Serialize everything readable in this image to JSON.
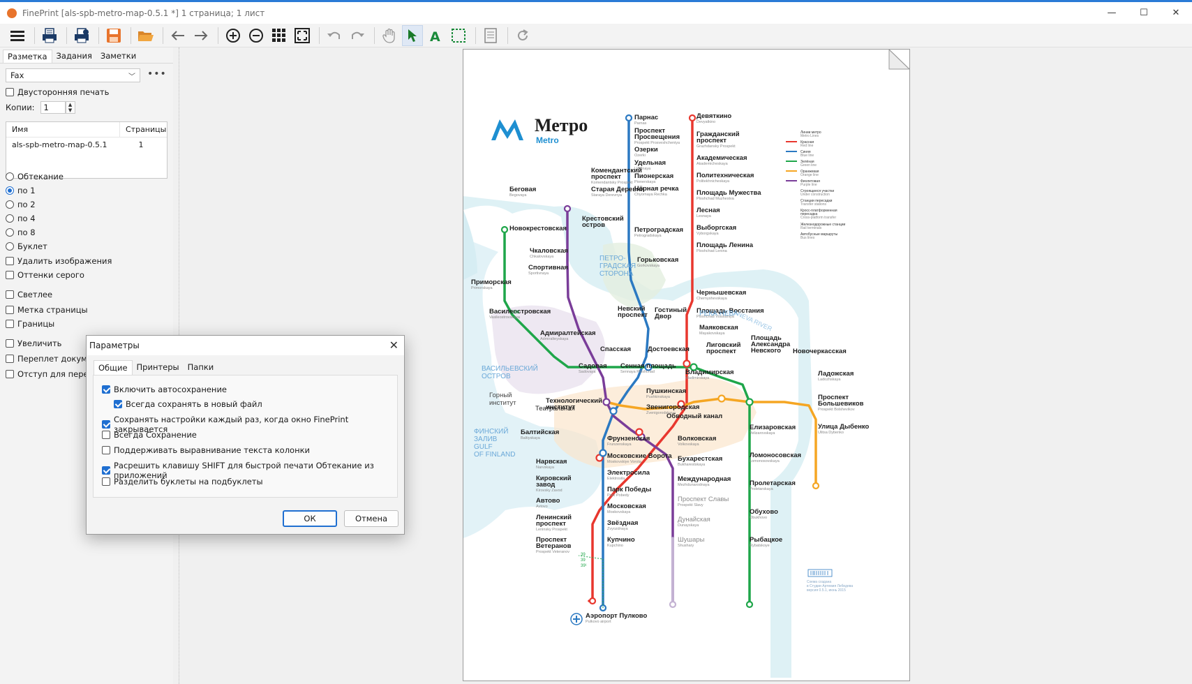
{
  "window": {
    "title": "FinePrint [als-spb-metro-map-0.5.1 *] 1 страница; 1 лист",
    "minimize": "—",
    "maximize": "☐",
    "close": "✕"
  },
  "toolbar": {
    "icons": [
      "menu-icon",
      "print-icon",
      "print-settings-icon",
      "save-icon",
      "open-folder-icon",
      "back-arrow-icon",
      "forward-arrow-icon",
      "zoom-in-icon",
      "zoom-out-icon",
      "grid-icon",
      "fit-page-icon",
      "undo-icon",
      "redo-icon",
      "hand-icon",
      "pointer-icon",
      "text-icon",
      "selection-icon",
      "notes-icon",
      "refresh-icon"
    ]
  },
  "left_panel": {
    "tabs": [
      "Разметка",
      "Задания",
      "Заметки"
    ],
    "printer": "Fax",
    "more": "•••",
    "duplex_label": "Двусторонняя печать",
    "copies_label": "Копии:",
    "copies_value": "1",
    "spin_up": "▲",
    "spin_down": "▼",
    "jobs_table": {
      "col_name": "Имя",
      "col_pages": "Страницы",
      "rows": [
        {
          "name": "als-spb-metro-map-0.5.1",
          "pages": "1"
        }
      ]
    },
    "layout_options": [
      "Обтекание",
      "по 1",
      "по 2",
      "по 4",
      "по 8",
      "Буклет"
    ],
    "selected_layout": "по 1",
    "remove_images": "Удалить изображения",
    "grayscale": "Оттенки серого",
    "lighter": "Светлее",
    "page_mark": "Метка страницы",
    "borders": "Границы",
    "enlarge": "Увеличить",
    "binding_doc": "Переплет докумен",
    "binding_margin": "Отступ для перепл"
  },
  "dialog": {
    "title": "Параметры",
    "close": "✕",
    "tabs": [
      "Общие",
      "Принтеры",
      "Папки"
    ],
    "options": [
      {
        "label": "Включить автосохранение",
        "checked": true
      },
      {
        "label": "Всегда сохранять в новый файл",
        "checked": true
      },
      {
        "label": "Сохранять настройки каждый раз, когда окно FinePrint закрывается",
        "checked": true
      },
      {
        "label": "Всегда Сохранение",
        "checked": false
      },
      {
        "label": "Поддерживать выравнивание текста колонки",
        "checked": false
      },
      {
        "label": "Расрешить клавишу SHIFT для быстрой печати Обтекание из приложений",
        "checked": true
      },
      {
        "label": "Разделить буклеты на подбуклеты",
        "checked": false
      }
    ],
    "ok": "ОК",
    "cancel": "Отмена"
  },
  "map": {
    "logo_title": "Метро",
    "logo_sub": "Metro",
    "colors": {
      "red": "#e8372e",
      "blue": "#2b79c2",
      "green": "#1fa64a",
      "orange": "#f5a623",
      "purple": "#7a3d99"
    },
    "red_line": [
      {
        "ru": "Девяткино",
        "en": "Devyatkino"
      },
      {
        "ru": "Гражданский",
        "ru2": "проспект",
        "en": "Grazhdansky Prospekt"
      },
      {
        "ru": "Академическая",
        "en": "Akademicheskaya"
      },
      {
        "ru": "Политехническая",
        "en": "Politekhnicheskaya"
      },
      {
        "ru": "Площадь Мужества",
        "en": "Ploshchad Muzhestva"
      },
      {
        "ru": "Лесная",
        "en": "Lesnaya"
      },
      {
        "ru": "Выборгская",
        "en": "Vyborgskaya"
      },
      {
        "ru": "Площадь Ленина",
        "en": "Ploshchad Lenina"
      },
      {
        "ru": "Чернышевская",
        "en": "Chernyshevskaya"
      },
      {
        "ru": "Площадь Восстания",
        "en": "Ploshchad Vosstaniya"
      },
      {
        "ru": "Владимирская",
        "en": "Vladimirskaya"
      },
      {
        "ru": "Пушкинская",
        "en": "Pushkinskaya"
      },
      {
        "ru": "Технологический",
        "ru2": "институт",
        "en": ""
      },
      {
        "ru": "Балтийская",
        "en": "Baltiyskaya"
      },
      {
        "ru": "Нарвская",
        "en": "Narvskaya"
      },
      {
        "ru": "Кировский",
        "ru2": "завод",
        "en": "Kirovsky Zavod"
      },
      {
        "ru": "Автово",
        "en": "Avtovo"
      },
      {
        "ru": "Ленинский",
        "ru2": "проспект",
        "en": "Leninsky Prospekt"
      },
      {
        "ru": "Проспект",
        "ru2": "Ветеранов",
        "en": "Prospekt Veteranov"
      }
    ],
    "blue_line": [
      {
        "ru": "Парнас",
        "en": "Parnas"
      },
      {
        "ru": "Проспект",
        "ru2": "Просвещения",
        "en": "Prospekt Prosveshcheniya"
      },
      {
        "ru": "Озерки",
        "en": "Ozerki"
      },
      {
        "ru": "Удельная",
        "en": "Udelnaya"
      },
      {
        "ru": "Пионерская",
        "en": "Pionerskaya"
      },
      {
        "ru": "Чёрная речка",
        "en": "Chyornaya Rechka"
      },
      {
        "ru": "Петроградская",
        "en": "Petrogradskaya"
      },
      {
        "ru": "Горьковская",
        "en": "Gorkovskaya"
      },
      {
        "ru": "Невский",
        "ru2": "проспект",
        "en": ""
      },
      {
        "ru": "Сенная площадь",
        "en": "Sennaya Ploshchad"
      },
      {
        "ru": "Фрунзенская",
        "en": "Frunzenskaya"
      },
      {
        "ru": "Московские Ворота",
        "en": "Moskovskiye Vorota"
      },
      {
        "ru": "Электросила",
        "en": "Elektrosila"
      },
      {
        "ru": "Парк Победы",
        "en": "Park Pobedy"
      },
      {
        "ru": "Московская",
        "en": "Moskovskaya"
      },
      {
        "ru": "Звёздная",
        "en": "Zvyozdnaya"
      },
      {
        "ru": "Купчино",
        "en": "Kupchino"
      }
    ],
    "green_line": [
      {
        "ru": "Беговая",
        "en": "Begovaya"
      },
      {
        "ru": "Новокрестовская",
        "en": ""
      },
      {
        "ru": "Приморская",
        "en": "Primorskaya"
      },
      {
        "ru": "Василеостровская",
        "en": "Vasileostrovskaya"
      },
      {
        "ru": "Гостиный",
        "ru2": "Двор",
        "en": ""
      },
      {
        "ru": "Маяковская",
        "en": "Mayakovskaya"
      },
      {
        "ru": "Площадь",
        "ru2": "Александра",
        "ru3": "Невского",
        "en": ""
      },
      {
        "ru": "Елизаровская",
        "en": "Yelizarovskaya"
      },
      {
        "ru": "Ломоносовская",
        "en": "Lomonosovskaya"
      },
      {
        "ru": "Пролетарская",
        "en": "Proletarskaya"
      },
      {
        "ru": "Обухово",
        "en": "Obukhovo"
      },
      {
        "ru": "Рыбацкое",
        "en": "Rybatskoye"
      }
    ],
    "orange_line": [
      {
        "ru": "Спасская",
        "en": ""
      },
      {
        "ru": "Достоевская",
        "en": ""
      },
      {
        "ru": "Лиговский",
        "ru2": "проспект",
        "en": ""
      },
      {
        "ru": "Новочеркасская",
        "en": ""
      },
      {
        "ru": "Ладожская",
        "en": "Ladozhskaya"
      },
      {
        "ru": "Проспект",
        "ru2": "Большевиков",
        "en": "Prospekt Bolshevikov"
      },
      {
        "ru": "Улица Дыбенко",
        "en": "Ulitsa Dybenko"
      }
    ],
    "purple_line": [
      {
        "ru": "Комендантский",
        "ru2": "проспект",
        "en": "Komendantsky Prospekt"
      },
      {
        "ru": "Старая Деревня",
        "en": "Staraya Derevnya"
      },
      {
        "ru": "Крестовский",
        "ru2": "остров",
        "en": ""
      },
      {
        "ru": "Чкаловская",
        "en": "Chkalovskaya"
      },
      {
        "ru": "Спортивная",
        "en": "Sportivnaya"
      },
      {
        "ru": "Адмиралтейская",
        "en": "Admiralteyskaya"
      },
      {
        "ru": "Садовая",
        "en": "Sadovaya"
      },
      {
        "ru": "Звенигородская",
        "en": "Zvenigorodskaya"
      },
      {
        "ru": "Обводный канал",
        "en": ""
      },
      {
        "ru": "Волковская",
        "en": "Volkovskaya"
      },
      {
        "ru": "Бухарестская",
        "en": "Bukharestskaya"
      },
      {
        "ru": "Международная",
        "en": "Mezhdunarodnaya"
      },
      {
        "ru": "Проспект Славы",
        "en": "Prospekt Slavy",
        "planned": true
      },
      {
        "ru": "Дунайская",
        "en": "Dunayskaya",
        "planned": true
      },
      {
        "ru": "Шушары",
        "en": "Shushary",
        "planned": true
      }
    ],
    "extra": {
      "airport": "Аэропорт Пулково",
      "airport_en": "Pulkovo airport",
      "teatralnaya": "Театральная",
      "gorny_1": "Горный",
      "gorny_2": "институт",
      "river": "РЕКА НЕВА",
      "river_en": "NEVA RIVER",
      "petro_1": "ПЕТРО-",
      "petro_2": "ГРАДСКАЯ",
      "petro_3": "СТОРОНА",
      "vo_1": "ВАСИЛЬЕВСКИЙ",
      "vo_2": "ОСТРОВ",
      "gulf_1": "ФИНСКИЙ",
      "gulf_2": "ЗАЛИВ",
      "gulf_3": "GULF",
      "gulf_4": "OF FINLAND",
      "bus": "158",
      "bus2": "39",
      "bus3": "39",
      "bus4": "39¹"
    },
    "legend": [
      {
        "ru": "Линии метро",
        "en": "Metro Lines"
      },
      {
        "ru": "Красная",
        "en": "Red line",
        "color": "#e8372e"
      },
      {
        "ru": "Синяя",
        "en": "Blue line",
        "color": "#2b79c2"
      },
      {
        "ru": "Зелёная",
        "en": "Green line",
        "color": "#1fa64a"
      },
      {
        "ru": "Оранжевая",
        "en": "Orange line",
        "color": "#f5a623"
      },
      {
        "ru": "Фиолетовая",
        "en": "Purple line",
        "color": "#7a3d99"
      },
      {
        "ru": "Строящиеся участки",
        "en": "Under construction"
      },
      {
        "ru": "Станции пересадки",
        "en": "Transfer stations"
      },
      {
        "ru": "Кросс-платформенная",
        "ru2": "пересадка",
        "en": "Cross-platform transfer"
      },
      {
        "ru": "Железнодорожные станции",
        "en": "Rail terminals"
      },
      {
        "ru": "Автобусные маршруты",
        "en": "Bus lines"
      }
    ],
    "footer": [
      "Схема создана",
      "в Студии Артемия Лебедева",
      "версия 0.5.1, июнь 2015"
    ]
  }
}
